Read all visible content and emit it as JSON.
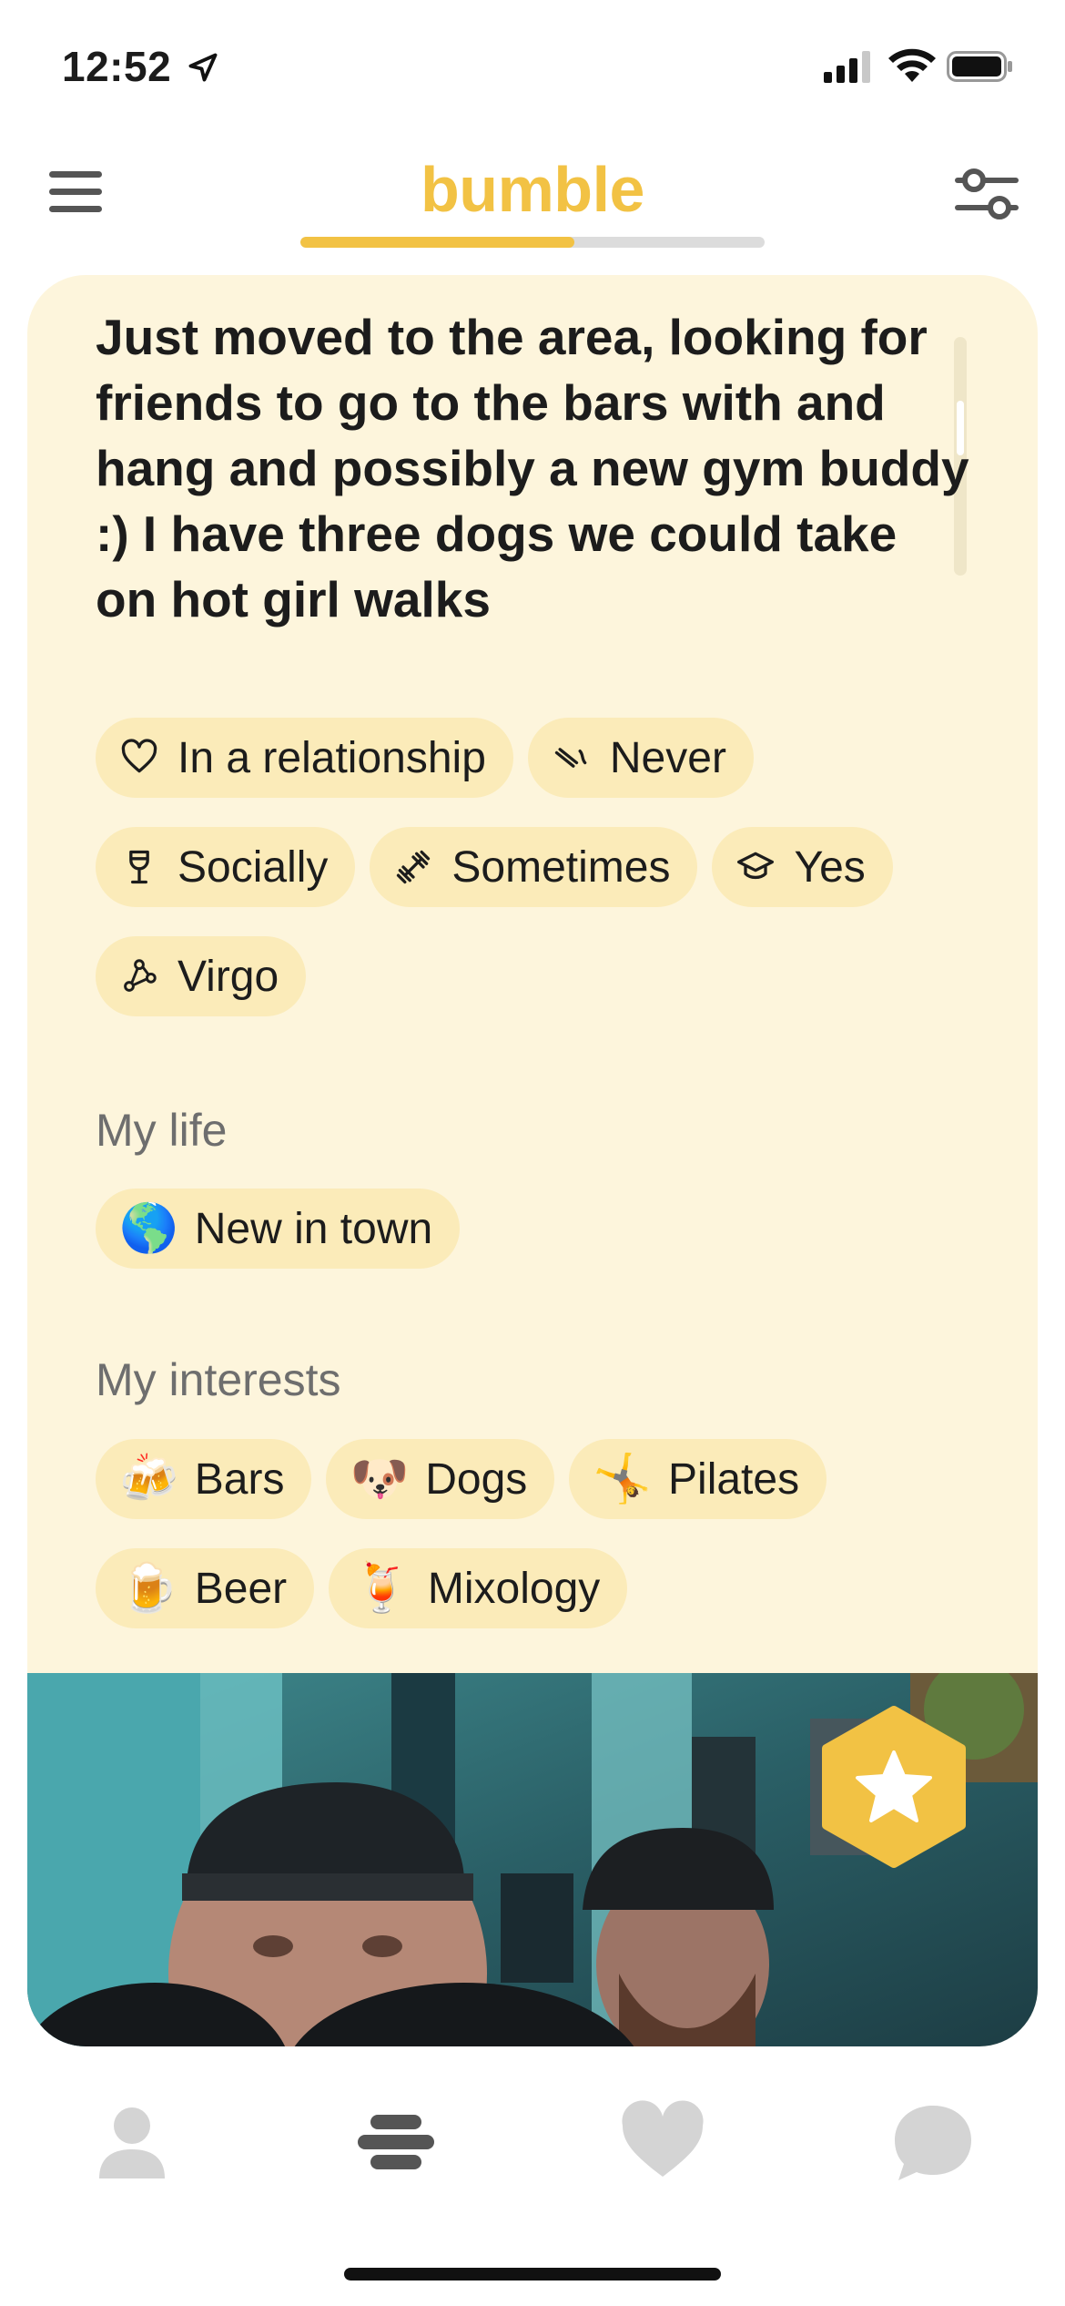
{
  "status_bar": {
    "time": "12:52"
  },
  "header": {
    "logo": "bumble",
    "progress_fraction": 0.59
  },
  "profile": {
    "bio": "Just moved to the area, looking for friends to go to the bars with and hang and possibly a new gym buddy :) I have three dogs we could take on hot girl walks",
    "basics": [
      {
        "icon": "heart-outline-icon",
        "label": "In a relationship"
      },
      {
        "icon": "cigarette-icon",
        "label": "Never"
      },
      {
        "icon": "wine-glass-icon",
        "label": "Socially"
      },
      {
        "icon": "dumbbell-icon",
        "label": "Sometimes"
      },
      {
        "icon": "graduation-cap-icon",
        "label": "Yes"
      },
      {
        "icon": "zodiac-icon",
        "label": "Virgo"
      }
    ],
    "my_life": {
      "title": "My life",
      "chips": [
        {
          "emoji": "🌎",
          "label": "New in town"
        }
      ]
    },
    "my_interests": {
      "title": "My interests",
      "chips": [
        {
          "emoji": "🍻",
          "label": "Bars"
        },
        {
          "emoji": "🐶",
          "label": "Dogs"
        },
        {
          "emoji": "🤸",
          "label": "Pilates"
        },
        {
          "emoji": "🍺",
          "label": "Beer"
        },
        {
          "emoji": "🍹",
          "label": "Mixology"
        }
      ]
    }
  },
  "bottom_nav": [
    {
      "name": "profile-tab",
      "icon": "person-icon"
    },
    {
      "name": "discover-tab",
      "icon": "bumble-stack-icon",
      "active": true
    },
    {
      "name": "likes-tab",
      "icon": "heart-icon"
    },
    {
      "name": "chats-tab",
      "icon": "chat-bubble-icon"
    }
  ],
  "colors": {
    "accent": "#F2C244",
    "card_bg": "#FDF5DC",
    "chip_bg": "#FBEBB9"
  }
}
